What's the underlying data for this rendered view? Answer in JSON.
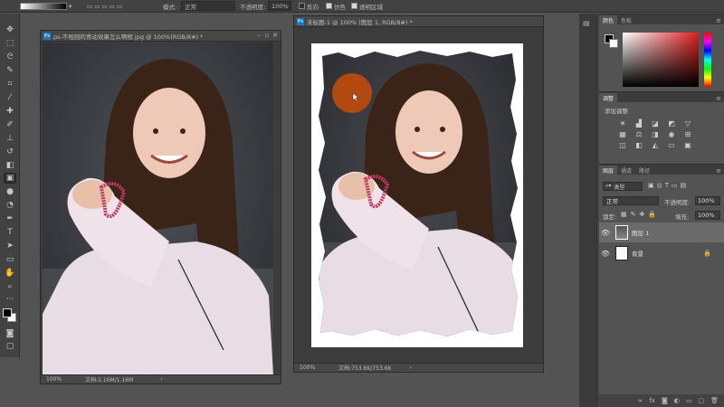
{
  "options_bar": {
    "mode_label": "模式:",
    "mode_value": "正常",
    "opacity_label": "不透明度:",
    "opacity_value": "100%",
    "reverse_label": "反向",
    "dither_label": "仿色",
    "transparency_label": "透明区域"
  },
  "doc_left": {
    "title": "ps-不规则的青动效果怎么啊框.jpg @ 100%(RGB/8#) *",
    "zoom": "100%",
    "doc_info": "文档:1.16M/1.16M"
  },
  "doc_right": {
    "title": "未标题-1 @ 100% (图层 1, RGB/8#) *",
    "zoom": "100%",
    "doc_info": "文档:753.6K/753.6K"
  },
  "panels": {
    "color_tabs": [
      "颜色",
      "色板"
    ],
    "adjust_tab": "调整",
    "adjust_add": "添加调整",
    "layers_tabs": [
      "图层",
      "通道",
      "路径"
    ],
    "kind_label": "类型",
    "blend_mode": "正常",
    "opacity_label": "不透明度:",
    "opacity_value": "100%",
    "lock_label": "锁定:",
    "fill_label": "填充:",
    "fill_value": "100%",
    "layers": [
      {
        "name": "图层 1"
      },
      {
        "name": "背景"
      }
    ]
  },
  "colors": {
    "app_bg": "#535353",
    "panel_dark": "#424242",
    "brush_dot": "#b24a10",
    "ps_blue": "#1e76c0"
  }
}
